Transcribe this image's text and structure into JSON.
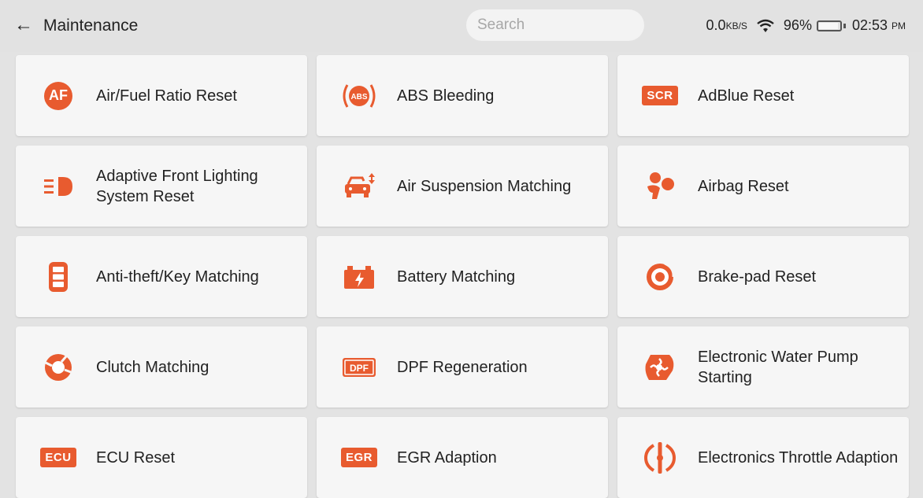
{
  "header": {
    "back_icon": "arrow-left-icon",
    "title": "Maintenance",
    "search_placeholder": "Search",
    "net_speed_value": "0.0",
    "net_speed_unit": "KB/S",
    "wifi_icon": "wifi-icon",
    "battery_percent": "96%",
    "time": "02:53",
    "ampm": "PM"
  },
  "accent_color": "#e85b2f",
  "tiles": [
    {
      "label": "Air/Fuel Ratio Reset",
      "icon": "af-badge-icon",
      "badge": "AF"
    },
    {
      "label": "ABS Bleeding",
      "icon": "abs-icon",
      "badge": "ABS"
    },
    {
      "label": "AdBlue Reset",
      "icon": "scr-badge-icon",
      "badge": "SCR"
    },
    {
      "label": "Adaptive Front Lighting System Reset",
      "icon": "headlight-icon"
    },
    {
      "label": "Air Suspension Matching",
      "icon": "car-suspension-icon"
    },
    {
      "label": "Airbag Reset",
      "icon": "airbag-icon"
    },
    {
      "label": "Anti-theft/Key Matching",
      "icon": "key-fob-icon"
    },
    {
      "label": "Battery Matching",
      "icon": "battery-icon"
    },
    {
      "label": "Brake-pad Reset",
      "icon": "brake-disc-icon"
    },
    {
      "label": "Clutch Matching",
      "icon": "clutch-icon"
    },
    {
      "label": "DPF Regeneration",
      "icon": "dpf-icon",
      "badge": "DPF"
    },
    {
      "label": "Electronic Water Pump Starting",
      "icon": "water-pump-icon"
    },
    {
      "label": "ECU Reset",
      "icon": "ecu-badge-icon",
      "badge": "ECU"
    },
    {
      "label": "EGR Adaption",
      "icon": "egr-badge-icon",
      "badge": "EGR"
    },
    {
      "label": "Electronics Throttle Adaption",
      "icon": "throttle-icon"
    }
  ]
}
